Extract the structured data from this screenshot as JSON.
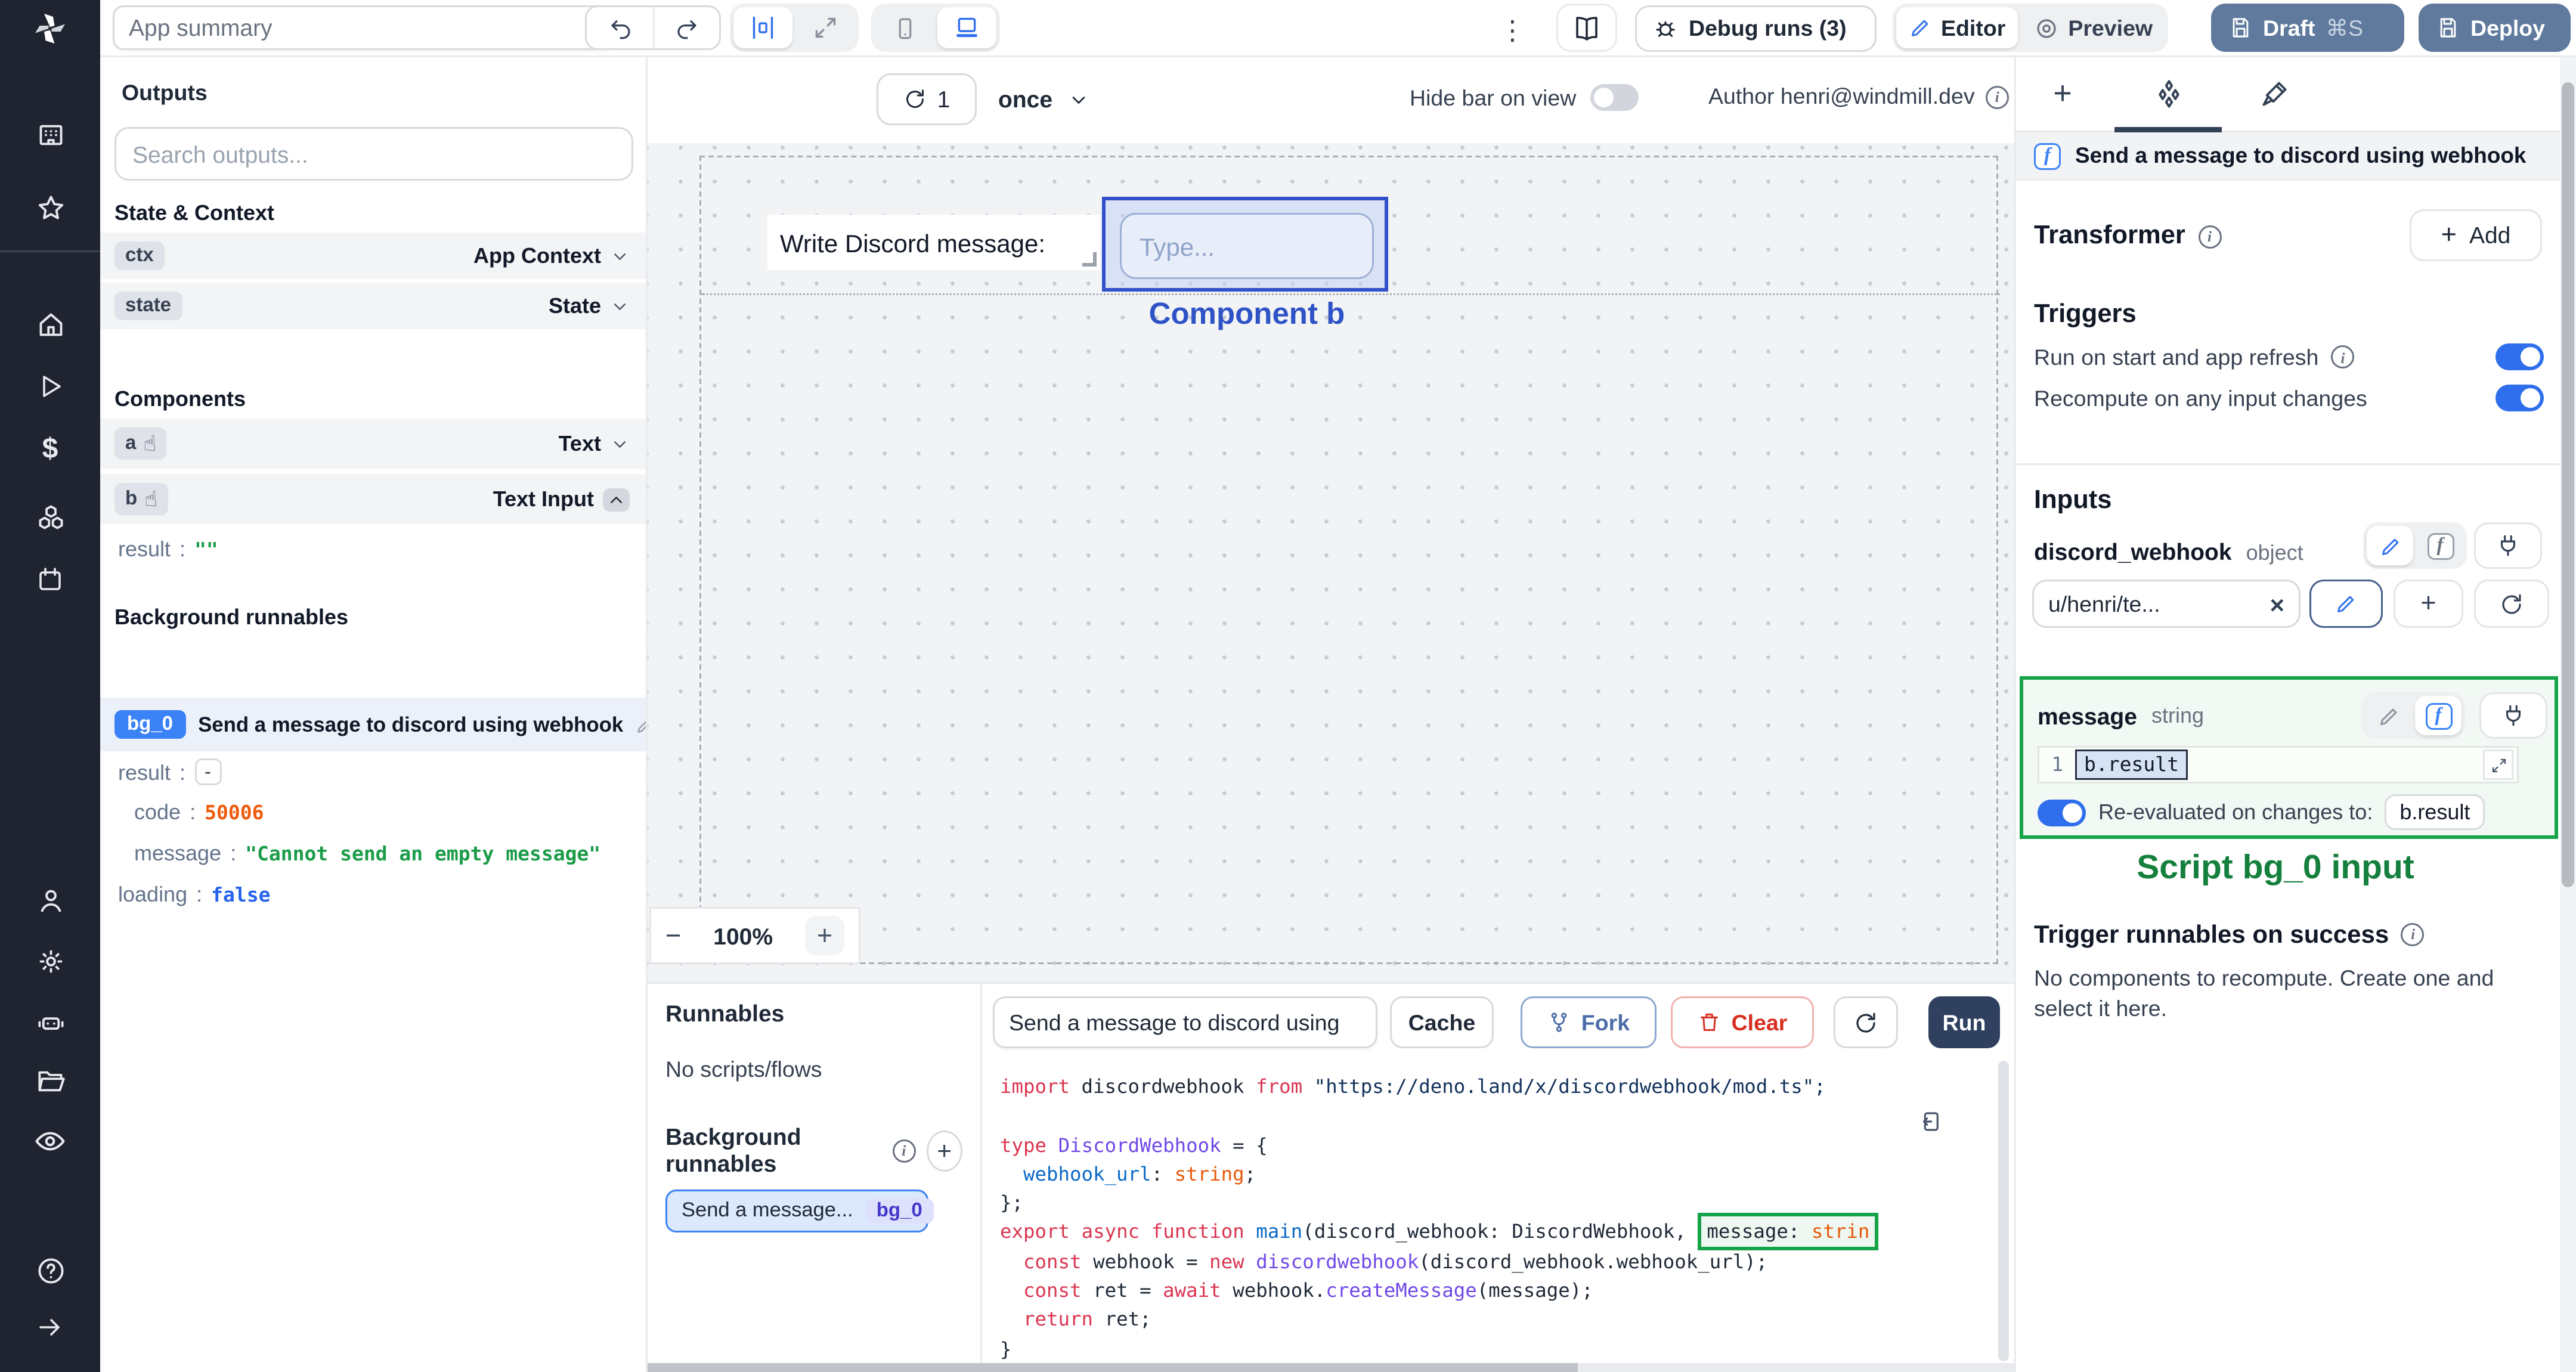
{
  "topbar": {
    "app_summary_value": "App summary",
    "debug_runs_label": "Debug runs (3)",
    "editor_label": "Editor",
    "preview_label": "Preview",
    "draft_label": "Draft",
    "draft_shortcut": "⌘S",
    "deploy_label": "Deploy"
  },
  "outputs": {
    "title": "Outputs",
    "search_placeholder": "Search outputs...",
    "state_context_title": "State & Context",
    "rows": {
      "ctx": {
        "id": "ctx",
        "type": "App Context"
      },
      "state": {
        "id": "state",
        "type": "State"
      }
    },
    "components_title": "Components",
    "components": {
      "a": {
        "id": "a",
        "type": "Text"
      },
      "b": {
        "id": "b",
        "type": "Text Input"
      }
    },
    "b_result": {
      "key": "result",
      "value": "\"\""
    },
    "background_title": "Background runnables",
    "bg": {
      "badge": "bg_0",
      "title": "Send a message to discord using webhook"
    },
    "json": {
      "result_key": "result",
      "result_value": "-",
      "code_key": "code",
      "code_value": "50006",
      "message_key": "message",
      "message_value": "\"Cannot send an empty message\"",
      "loading_key": "loading",
      "loading_value": "false"
    }
  },
  "canvas": {
    "refresh_count": "1",
    "interval_value": "once",
    "hide_bar_label": "Hide bar on view",
    "author_label": "Author henri@windmill.dev",
    "text_component_value": "Write Discord message:",
    "input_placeholder": "Type...",
    "selection_label": "Component b",
    "zoom_out_label": "−",
    "zoom_level": "100%",
    "zoom_in_label": "+"
  },
  "runnables": {
    "title": "Runnables",
    "empty_label": "No scripts/flows",
    "background_title": "Background runnables",
    "item_name": "Send a message...",
    "item_badge": "bg_0"
  },
  "editor": {
    "script_name": "Send a message to discord using",
    "cache_label": "Cache",
    "fork_label": "Fork",
    "clear_label": "Clear",
    "run_label": "Run",
    "code_lines": [
      [
        [
          "import",
          "kw"
        ],
        [
          " discordwebhook ",
          "pl"
        ],
        [
          "from",
          "kw"
        ],
        [
          " ",
          "pl"
        ],
        [
          "\"https://deno.land/x/discordwebhook/mod.ts\";",
          "str"
        ]
      ],
      [],
      [
        [
          "type",
          "kw"
        ],
        [
          " ",
          "pl"
        ],
        [
          "DiscordWebhook",
          "cls"
        ],
        [
          " = {",
          "pl"
        ]
      ],
      [
        [
          "  ",
          "pl"
        ],
        [
          "webhook_url",
          "prop"
        ],
        [
          ": ",
          "pl"
        ],
        [
          "string",
          "bi"
        ],
        [
          ";",
          "pl"
        ]
      ],
      [
        [
          "};",
          "pl"
        ]
      ],
      [
        [
          "export",
          "kw"
        ],
        [
          " ",
          "pl"
        ],
        [
          "async",
          "kw"
        ],
        [
          " ",
          "pl"
        ],
        [
          "function",
          "kw"
        ],
        [
          " ",
          "pl"
        ],
        [
          "main",
          "fn"
        ],
        [
          "(discord_webhook: DiscordWebhook, ",
          "pl"
        ],
        [
          "message: ",
          "pl hl hl-l"
        ],
        [
          "strin",
          "bi hl hl-r"
        ]
      ],
      [
        [
          "  ",
          "pl"
        ],
        [
          "const",
          "kw"
        ],
        [
          " webhook = ",
          "pl"
        ],
        [
          "new",
          "kw"
        ],
        [
          " ",
          "pl"
        ],
        [
          "discordwebhook",
          "cls"
        ],
        [
          "(discord_webhook.webhook_url);",
          "pl"
        ]
      ],
      [
        [
          "  ",
          "pl"
        ],
        [
          "const",
          "kw"
        ],
        [
          " ret = ",
          "pl"
        ],
        [
          "await",
          "kw"
        ],
        [
          " webhook.",
          "pl"
        ],
        [
          "createMessage",
          "cls"
        ],
        [
          "(message);",
          "pl"
        ]
      ],
      [
        [
          "  ",
          "pl"
        ],
        [
          "return",
          "kw"
        ],
        [
          " ret;",
          "pl"
        ]
      ],
      [
        [
          "}",
          "pl"
        ]
      ]
    ]
  },
  "panel": {
    "header_title": "Send a message to discord using webhook",
    "transformer_label": "Transformer",
    "add_label": "Add",
    "triggers_title": "Triggers",
    "run_on_start_label": "Run on start and app refresh",
    "recompute_label": "Recompute on any input changes",
    "inputs_title": "Inputs",
    "field1_name": "discord_webhook",
    "field1_type": "object",
    "field1_value": "u/henri/te...",
    "field2_name": "message",
    "field2_type": "string",
    "line_number": "1",
    "field2_expr": "b.result",
    "reeval_label": "Re-evaluated on changes to:",
    "reeval_target": "b.result",
    "annotation": "Script bg_0 input",
    "success_title": "Trigger runnables on success",
    "success_text": "No components to recompute. Create one and select it here."
  },
  "colors": {
    "accent_blue": "#2f6fed",
    "selection_blue": "#3250c9",
    "badge_blue": "#3b82f6",
    "success_green": "#16a34a",
    "annotation_green": "#15803d",
    "error_orange": "#ee5b0c",
    "deploy_slate": "#5f7a9d",
    "sidebar_dark": "#1f2430"
  }
}
